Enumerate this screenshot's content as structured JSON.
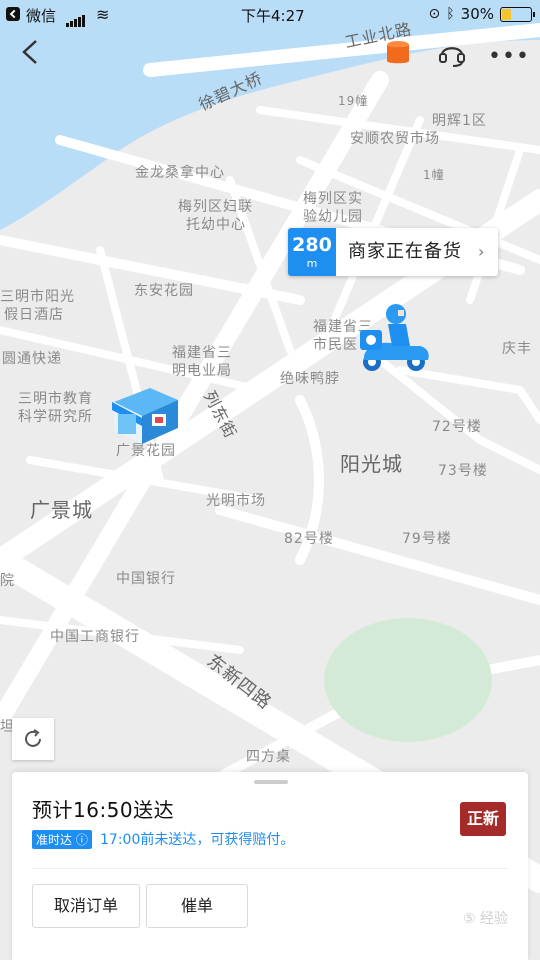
{
  "status_bar": {
    "app": "微信",
    "time": "下午4:27",
    "battery": "30%",
    "battery_level": 0.3
  },
  "map": {
    "labels": [
      {
        "text": "工业北路",
        "cls": "road",
        "rot": "-12deg",
        "id": "road-gongye-north"
      },
      {
        "text": "徐碧大桥",
        "cls": "road",
        "rot": "-25deg",
        "id": "bridge-xubi"
      },
      {
        "text": "19幢",
        "cls": "",
        "id": "bldg-19"
      },
      {
        "text": "明辉1区",
        "cls": "",
        "id": "poi-minghui"
      },
      {
        "text": "安顺农贸市场",
        "cls": "",
        "id": "poi-anshun-market"
      },
      {
        "text": "1幢",
        "cls": "",
        "id": "bldg-1"
      },
      {
        "text": "金龙桑拿中心",
        "cls": "",
        "id": "poi-jinlong-sauna"
      },
      {
        "text": "梅列区妇联",
        "cls": "",
        "id": "poi-women-fed"
      },
      {
        "text": "托幼中心",
        "cls": "",
        "id": "poi-childcare"
      },
      {
        "text": "梅列区实",
        "cls": "",
        "id": "poi-kindergarten-1"
      },
      {
        "text": "验幼儿园",
        "cls": "",
        "id": "poi-kindergarten-2"
      },
      {
        "text": "三明市阳光",
        "cls": "",
        "id": "poi-sunshine-hotel-1"
      },
      {
        "text": "假日酒店",
        "cls": "",
        "id": "poi-sunshine-hotel-2"
      },
      {
        "text": "东安花园",
        "cls": "",
        "id": "poi-dongan-garden"
      },
      {
        "text": "福建省三",
        "cls": "",
        "id": "poi-hospital-1"
      },
      {
        "text": "市民医",
        "cls": "",
        "id": "poi-hospital-2"
      },
      {
        "text": "庆丰",
        "cls": "",
        "id": "poi-qingfeng"
      },
      {
        "text": "圆通快递",
        "cls": "",
        "id": "poi-yuantong"
      },
      {
        "text": "福建省三",
        "cls": "",
        "id": "poi-electric-1"
      },
      {
        "text": "明电业局",
        "cls": "",
        "id": "poi-electric-2"
      },
      {
        "text": "绝味鸭脖",
        "cls": "",
        "id": "poi-juewei"
      },
      {
        "text": "三明市教育",
        "cls": "",
        "id": "poi-education-1"
      },
      {
        "text": "科学研究所",
        "cls": "",
        "id": "poi-education-2"
      },
      {
        "text": "列东街",
        "cls": "road",
        "rot": "62deg",
        "id": "road-liedong"
      },
      {
        "text": "广景花园",
        "cls": "",
        "id": "poi-guangjing-garden"
      },
      {
        "text": "72号楼",
        "cls": "",
        "id": "bldg-72"
      },
      {
        "text": "阳光城",
        "cls": "big",
        "id": "area-yangguangcheng"
      },
      {
        "text": "73号楼",
        "cls": "",
        "id": "bldg-73"
      },
      {
        "text": "广景城",
        "cls": "big",
        "id": "area-guangjingcheng"
      },
      {
        "text": "光明市场",
        "cls": "",
        "id": "poi-guangming-market"
      },
      {
        "text": "82号楼",
        "cls": "",
        "id": "bldg-82"
      },
      {
        "text": "79号楼",
        "cls": "",
        "id": "bldg-79"
      },
      {
        "text": "院",
        "cls": "",
        "id": "poi-yuan"
      },
      {
        "text": "中国银行",
        "cls": "",
        "id": "poi-boc"
      },
      {
        "text": "中国工商银行",
        "cls": "",
        "id": "poi-icbc"
      },
      {
        "text": "东新四路",
        "cls": "road",
        "rot": "38deg",
        "id": "road-dongxin4"
      },
      {
        "text": "四方桌",
        "cls": "",
        "id": "poi-sifangzhuo"
      },
      {
        "text": "坦",
        "cls": "",
        "id": "poi-edge"
      }
    ]
  },
  "distance": {
    "value": "280",
    "unit": "m",
    "status": "商家正在备货",
    "arrow": "›"
  },
  "panel": {
    "eta": "预计16:50送达",
    "ontime_badge": "准时达 ⓘ",
    "ontime_text": "17:00前未送达，可获得赔付。",
    "merchant_logo": "正新",
    "cancel_label": "取消订单",
    "urge_label": "催单",
    "watermark": "⑤ 经验"
  },
  "colors": {
    "accent": "#1f8ef1",
    "river": "#b9ddf7",
    "park": "#d3ead6",
    "order_icon": "#f26b1d"
  }
}
